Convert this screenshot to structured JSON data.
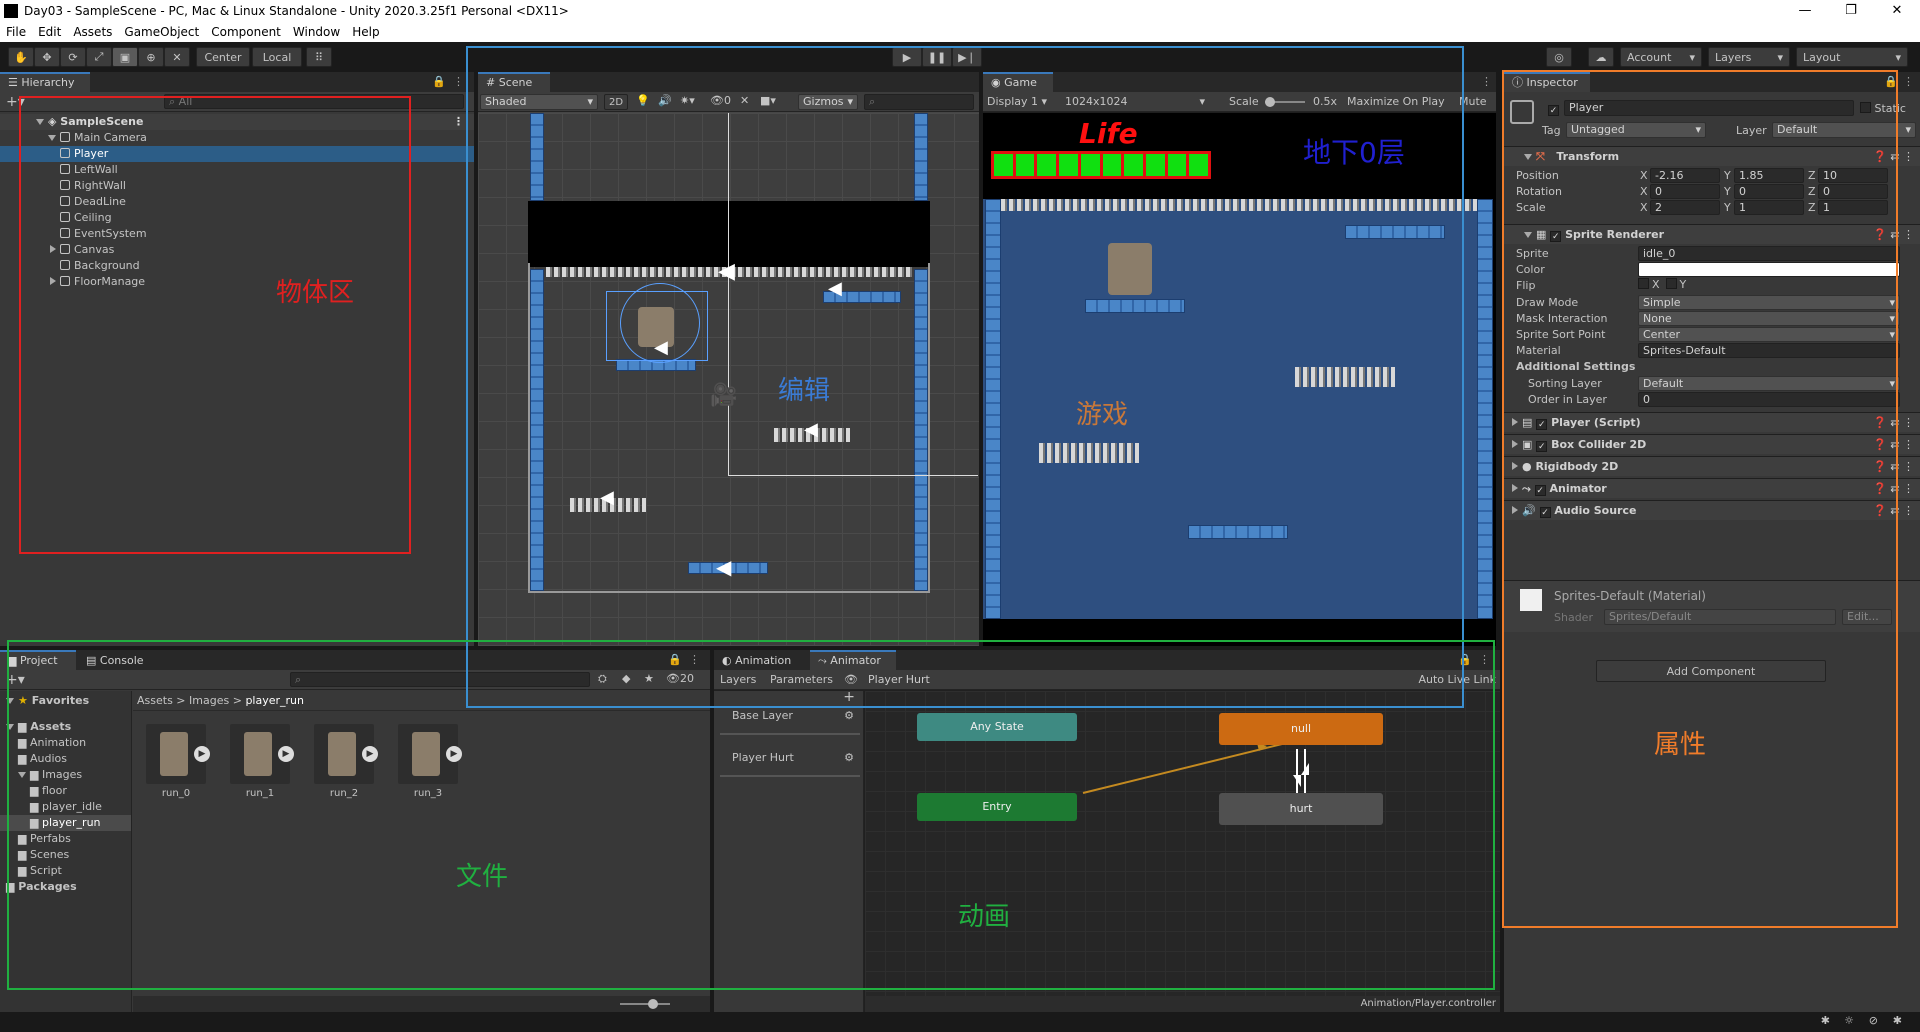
{
  "window": {
    "title": "Day03 - SampleScene - PC, Mac & Linux Standalone - Unity 2020.3.25f1 Personal <DX11>",
    "controls": [
      "—",
      "❐",
      "✕"
    ]
  },
  "menu": [
    "File",
    "Edit",
    "Assets",
    "GameObject",
    "Component",
    "Window",
    "Help"
  ],
  "toolbar": {
    "pivot": "Center",
    "space": "Local",
    "account": "Account",
    "layers": "Layers",
    "layout": "Layout"
  },
  "hierarchy": {
    "tab": "Hierarchy",
    "search_placeholder": "All",
    "scene": "SampleScene",
    "items": [
      {
        "label": "Main Camera",
        "depth": 1
      },
      {
        "label": "Player",
        "depth": 2,
        "selected": true
      },
      {
        "label": "LeftWall",
        "depth": 2
      },
      {
        "label": "RightWall",
        "depth": 2
      },
      {
        "label": "DeadLine",
        "depth": 2
      },
      {
        "label": "Ceiling",
        "depth": 2
      },
      {
        "label": "EventSystem",
        "depth": 2
      },
      {
        "label": "Canvas",
        "depth": 2,
        "collapsed": true
      },
      {
        "label": "Background",
        "depth": 2
      },
      {
        "label": "FloorManage",
        "depth": 2,
        "collapsed": true
      }
    ]
  },
  "scene": {
    "tab": "Scene",
    "shading": "Shaded",
    "mode2d": "2D",
    "gizmos": "Gizmos",
    "hidden_count": "0"
  },
  "game": {
    "tab": "Game",
    "display": "Display 1",
    "resolution": "1024x1024",
    "scale_label": "Scale",
    "scale_value": "0.5x",
    "maximize": "Maximize On Play",
    "mute": "Mute A",
    "life_label": "Life",
    "floor_label": "地下0层",
    "life_cells": 10
  },
  "inspector": {
    "tab": "Inspector",
    "object_name": "Player",
    "static": "Static",
    "tag_label": "Tag",
    "tag": "Untagged",
    "layer_label": "Layer",
    "layer": "Default",
    "transform": {
      "title": "Transform",
      "position": {
        "label": "Position",
        "x": "-2.16",
        "y": "1.85",
        "z": "10"
      },
      "rotation": {
        "label": "Rotation",
        "x": "0",
        "y": "0",
        "z": "0"
      },
      "scale": {
        "label": "Scale",
        "x": "2",
        "y": "1",
        "z": "1"
      }
    },
    "sprite_renderer": {
      "title": "Sprite Renderer",
      "sprite_label": "Sprite",
      "sprite": "idle_0",
      "color_label": "Color",
      "color": "#ffffff",
      "flip_label": "Flip",
      "flip_x": "X",
      "flip_y": "Y",
      "draw_mode_label": "Draw Mode",
      "draw_mode": "Simple",
      "mask_label": "Mask Interaction",
      "mask": "None",
      "sort_point_label": "Sprite Sort Point",
      "sort_point": "Center",
      "material_label": "Material",
      "material": "Sprites-Default",
      "additional": "Additional Settings",
      "sorting_layer_label": "Sorting Layer",
      "sorting_layer": "Default",
      "order_label": "Order in Layer",
      "order": "0"
    },
    "components": [
      "Player (Script)",
      "Box Collider 2D",
      "Rigidbody 2D",
      "Animator",
      "Audio Source"
    ],
    "material_name": "Sprites-Default (Material)",
    "shader_label": "Shader",
    "shader": "Sprites/Default",
    "edit": "Edit...",
    "add_component": "Add Component"
  },
  "project": {
    "tabs": [
      "Project",
      "Console"
    ],
    "hidden_count": "20",
    "favorites": "Favorites",
    "tree": [
      {
        "label": "Assets",
        "depth": 0,
        "bold": true
      },
      {
        "label": "Animation",
        "depth": 1
      },
      {
        "label": "Audios",
        "depth": 1
      },
      {
        "label": "Images",
        "depth": 1
      },
      {
        "label": "floor",
        "depth": 2
      },
      {
        "label": "player_idle",
        "depth": 2
      },
      {
        "label": "player_run",
        "depth": 2,
        "selected": true
      },
      {
        "label": "Perfabs",
        "depth": 1
      },
      {
        "label": "Scenes",
        "depth": 1
      },
      {
        "label": "Script",
        "depth": 1
      },
      {
        "label": "Packages",
        "depth": 0,
        "bold": true
      }
    ],
    "breadcrumb": [
      "Assets",
      "Images",
      "player_run"
    ],
    "assets": [
      "run_0",
      "run_1",
      "run_2",
      "run_3"
    ]
  },
  "animator": {
    "tabs": [
      "Animation",
      "Animator"
    ],
    "sub_tabs": [
      "Layers",
      "Parameters"
    ],
    "current": "Player Hurt",
    "auto_live": "Auto Live Link",
    "layers": [
      "Base Layer",
      "Player Hurt"
    ],
    "nodes": {
      "any_state": "Any State",
      "null": "null",
      "entry": "Entry",
      "hurt": "hurt"
    },
    "footer": "Animation/Player.controller"
  },
  "annotations": {
    "objects": {
      "label": "物体区",
      "color": "#e02020"
    },
    "edit": {
      "label": "编辑",
      "color": "#3a7bd5"
    },
    "game": {
      "label": "游戏",
      "color": "#c8783a"
    },
    "attributes": {
      "label": "属性",
      "color": "#f07c2a"
    },
    "files": {
      "label": "文件",
      "color": "#20b040"
    },
    "anim": {
      "label": "动画",
      "color": "#20b040"
    }
  }
}
